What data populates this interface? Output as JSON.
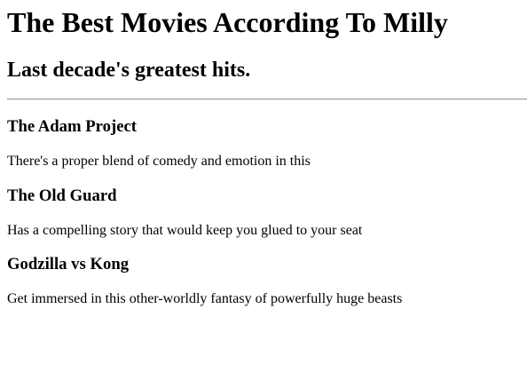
{
  "header": {
    "title": "The Best Movies According To Milly",
    "subtitle": "Last decade's greatest hits."
  },
  "movies": [
    {
      "title": "The Adam Project",
      "description": "There's a proper blend of comedy and emotion in this"
    },
    {
      "title": "The Old Guard",
      "description": "Has a compelling story that would keep you glued to your seat"
    },
    {
      "title": "Godzilla vs Kong",
      "description": "Get immersed in this other-worldly fantasy of powerfully huge beasts"
    }
  ]
}
